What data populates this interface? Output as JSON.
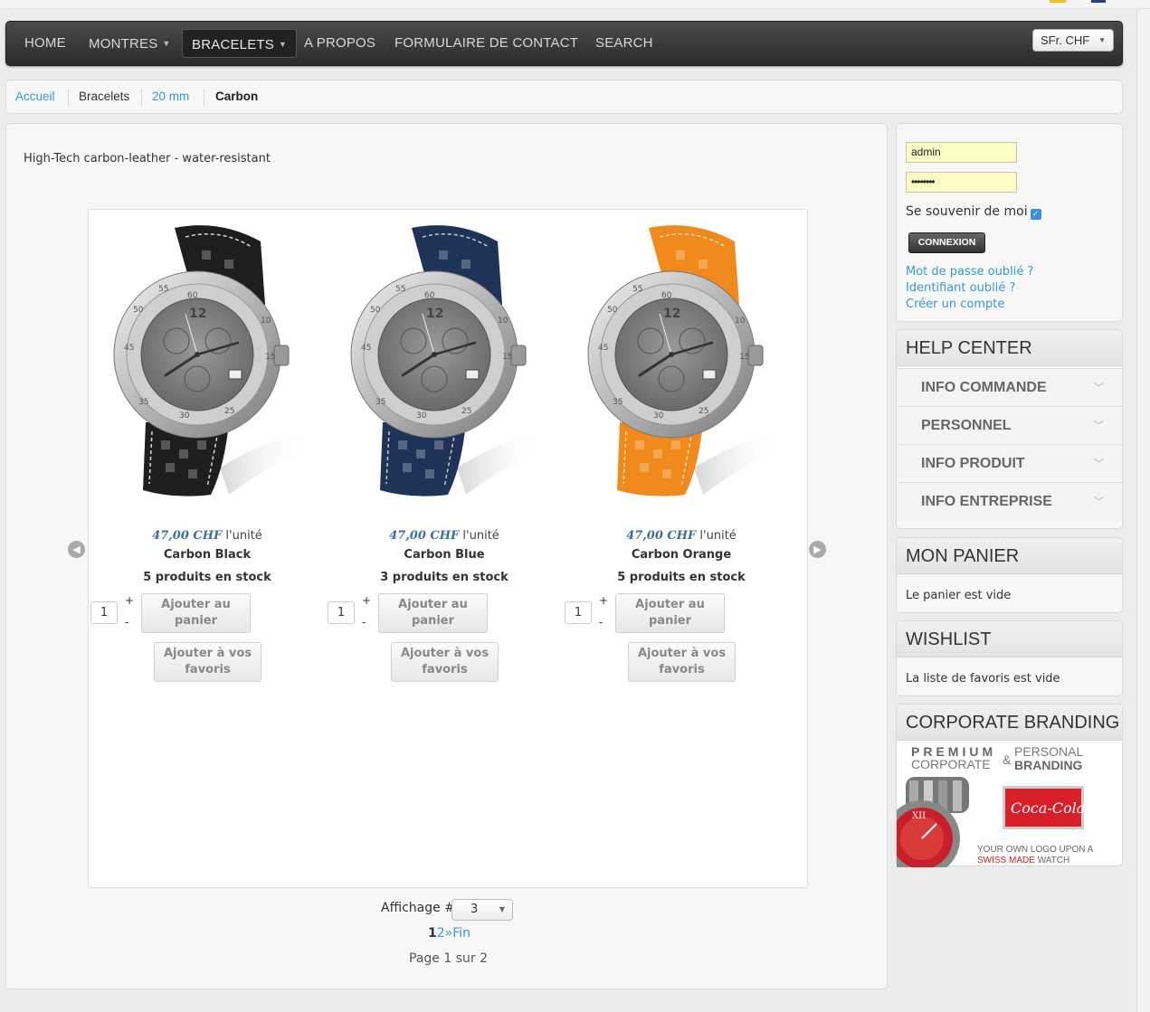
{
  "nav": {
    "items": [
      {
        "label": "HOME",
        "dropdown": false
      },
      {
        "label": "MONTRES",
        "dropdown": true
      },
      {
        "label": "BRACELETS",
        "dropdown": true,
        "active": true
      },
      {
        "label": "A PROPOS",
        "dropdown": false
      },
      {
        "label": "FORMULAIRE DE CONTACT",
        "dropdown": false
      },
      {
        "label": "SEARCH",
        "dropdown": false
      }
    ],
    "currency": "SFr. CHF"
  },
  "breadcrumb": [
    "Accueil",
    "Bracelets",
    "20 mm",
    "Carbon"
  ],
  "category": {
    "description": "High-Tech carbon-leather - water-resistant"
  },
  "products": [
    {
      "price": "47,00 CHF",
      "unit": "l'unité",
      "name": "Carbon Black",
      "stock": "5 produits en stock",
      "qty": "1",
      "strap_color": "#1e1e1e",
      "stitch_color": "#d8d8d0"
    },
    {
      "price": "47,00 CHF",
      "unit": "l'unité",
      "name": "Carbon Blue",
      "stock": "3 produits en stock",
      "qty": "1",
      "strap_color": "#1e3357",
      "stitch_color": "#c9c9c0"
    },
    {
      "price": "47,00 CHF",
      "unit": "l'unité",
      "name": "Carbon Orange",
      "stock": "5 produits en stock",
      "qty": "1",
      "strap_color": "#f08a1c",
      "stitch_color": "#f5e1c0"
    }
  ],
  "product_labels": {
    "qty_plus": "+",
    "qty_minus": "-",
    "add_to_cart": "Ajouter au panier",
    "add_to_favorites": "Ajouter à vos favoris"
  },
  "watch_dial": {
    "numerals": [
      "60",
      "55",
      "50",
      "45",
      "10",
      "15",
      "35",
      "30",
      "25",
      "12"
    ]
  },
  "pagination": {
    "label": "Affichage #",
    "per_page": "3",
    "current": "1",
    "next_page": "2",
    "next": "»",
    "end": "Fin",
    "summary": "Page 1 sur 2"
  },
  "login": {
    "username": "admin",
    "password_mask": "••••••••",
    "remember_label": "Se souvenir de moi",
    "button": "CONNEXION",
    "links": [
      "Mot de passe oublié ?",
      "Identifiant oublié ?",
      "Créer un compte"
    ]
  },
  "help_center": {
    "title": "HELP CENTER",
    "items": [
      "INFO COMMANDE",
      "PERSONNEL",
      "INFO PRODUIT",
      "INFO ENTREPRISE"
    ]
  },
  "cart": {
    "title": "MON PANIER",
    "text": "Le panier est vide"
  },
  "wishlist": {
    "title": "WISHLIST",
    "text": "La liste de favoris est vide"
  },
  "branding": {
    "title": "CORPORATE BRANDING",
    "art_text": {
      "premium": "PREMIUM",
      "corporate": "CORPORATE",
      "amp": "&",
      "personal": "PERSONAL",
      "branding": "BRANDING",
      "logo": "Coca-Cola",
      "tagline_1": "YOUR OWN LOGO UPON A",
      "tagline_2a": "SWISS MADE",
      "tagline_2b": "WATCH"
    }
  }
}
